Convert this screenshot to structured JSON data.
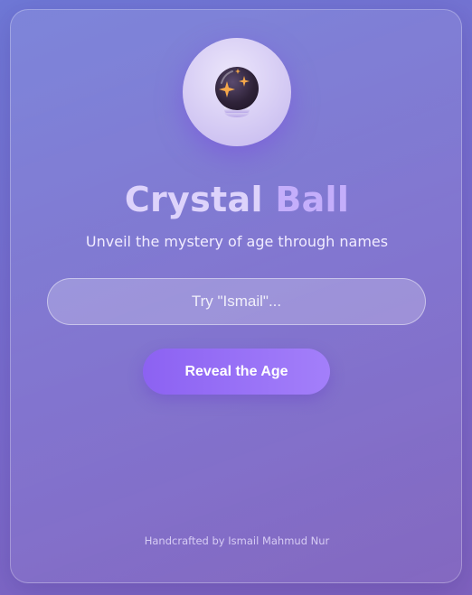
{
  "app": {
    "title_word1": "Crystal",
    "title_word2": "Ball",
    "subtitle": "Unveil the mystery of age through names",
    "icon": "crystal-ball-icon"
  },
  "form": {
    "input_value": "",
    "input_placeholder": "Try \"Ismail\"...",
    "button_label": "Reveal the Age"
  },
  "footer": {
    "credit": "Handcrafted by Ismail Mahmud Nur"
  },
  "colors": {
    "background": "#7470d0",
    "accent": "#9670f6",
    "title": "#ddd3fb",
    "title_accent": "#c4aefb",
    "sparkle": "#f5a84a"
  }
}
